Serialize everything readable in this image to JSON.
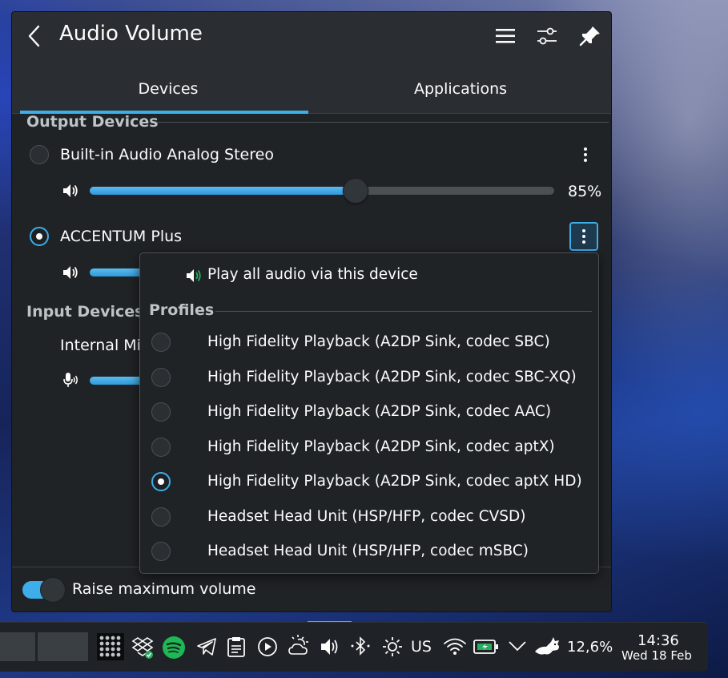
{
  "popup": {
    "title": "Audio Volume",
    "tabs": [
      {
        "label": "Devices",
        "active": true
      },
      {
        "label": "Applications",
        "active": false
      }
    ],
    "output_section": "Output Devices",
    "input_section": "Input Devices",
    "output_devices": [
      {
        "name": "Built-in Audio Analog Stereo",
        "selected": false,
        "volume_percent": 85,
        "volume_label": "85%"
      },
      {
        "name": "ACCENTUM Plus",
        "selected": true
      }
    ],
    "input_devices": [
      {
        "name": "Internal Mi"
      }
    ],
    "raise_max_label": "Raise maximum volume",
    "raise_max_on": true
  },
  "context_menu": {
    "play_all_label": "Play all audio via this device",
    "profiles_title": "Profiles",
    "profiles": [
      {
        "label": "High Fidelity Playback (A2DP Sink, codec SBC)",
        "selected": false
      },
      {
        "label": "High Fidelity Playback (A2DP Sink, codec SBC-XQ)",
        "selected": false
      },
      {
        "label": "High Fidelity Playback (A2DP Sink, codec AAC)",
        "selected": false
      },
      {
        "label": "High Fidelity Playback (A2DP Sink, codec aptX)",
        "selected": false
      },
      {
        "label": "High Fidelity Playback (A2DP Sink, codec aptX HD)",
        "selected": true
      },
      {
        "label": "Headset Head Unit (HSP/HFP, codec CVSD)",
        "selected": false
      },
      {
        "label": "Headset Head Unit (HSP/HFP, codec mSBC)",
        "selected": false
      }
    ]
  },
  "taskbar": {
    "keyboard_layout": "US",
    "battery_percent": "12,6%",
    "clock_time": "14:36",
    "clock_date": "Wed 18 Feb",
    "tray_icons": [
      "app-grid-icon",
      "dropbox-icon",
      "spotify-icon",
      "telegram-icon",
      "clipboard-icon",
      "media-play-icon",
      "weather-icon",
      "volume-icon",
      "bluetooth-icon",
      "brightness-icon",
      "wifi-icon",
      "battery-icon",
      "expand-tray-icon",
      "fox-icon"
    ]
  },
  "colors": {
    "accent": "#3daee9",
    "background": "#202326",
    "header": "#2a2e32",
    "spotify": "#1db954"
  }
}
